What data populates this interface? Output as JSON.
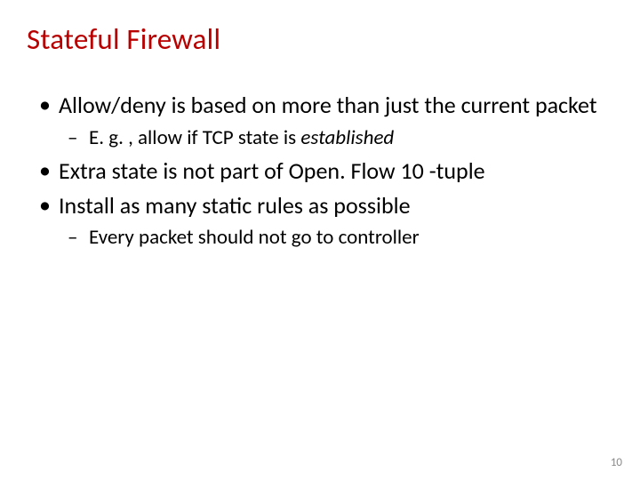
{
  "slide": {
    "title": "Stateful Firewall",
    "bullets": [
      {
        "text": "Allow/deny is based on more than just the current packet",
        "sub": [
          {
            "prefix": "E. g. , allow if TCP state is ",
            "italic": "established"
          }
        ]
      },
      {
        "text": "Extra state is not part of Open. Flow 10 -tuple"
      },
      {
        "text": "Install as many static rules as possible",
        "sub": [
          {
            "prefix": "Every packet should not go to controller"
          }
        ]
      }
    ],
    "page_number": "10"
  }
}
